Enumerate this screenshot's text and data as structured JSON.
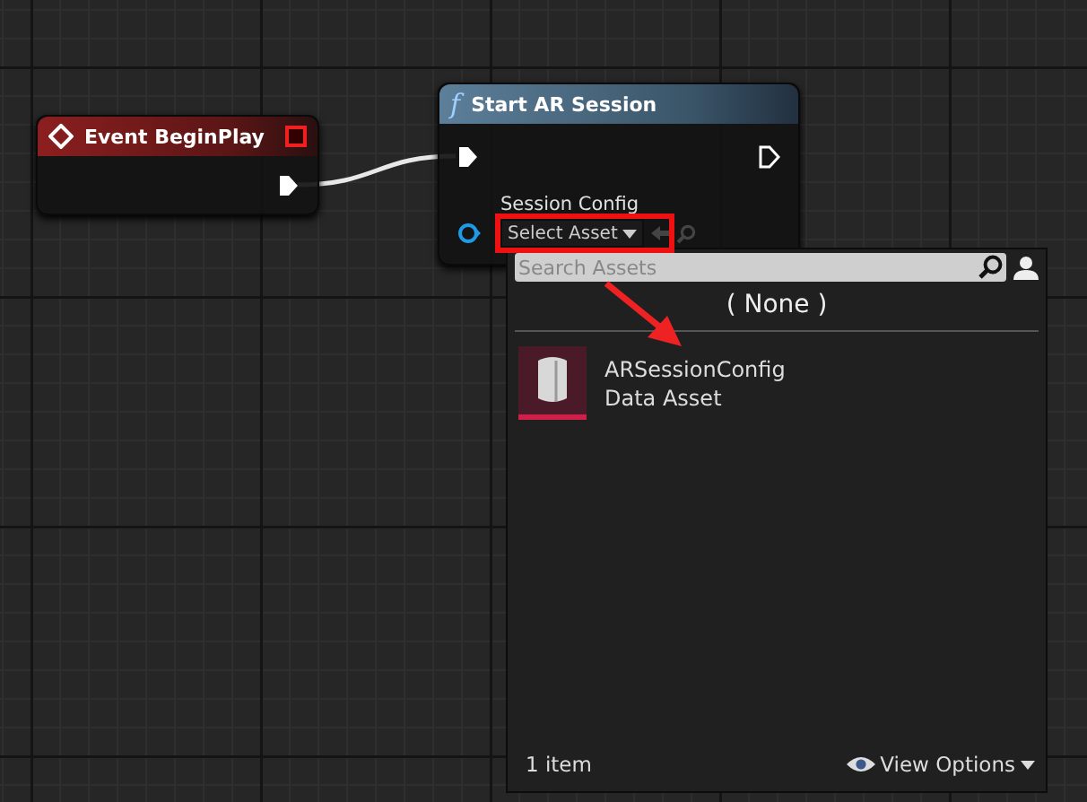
{
  "nodes": [
    {
      "kind": "event",
      "title": "Event BeginPlay"
    },
    {
      "kind": "function",
      "icon_text": "f",
      "title": "Start AR Session",
      "pin_label": "Session Config",
      "select_label": "Select Asset"
    }
  ],
  "picker": {
    "search": {
      "placeholder": "Search Assets"
    },
    "none_option": "( None )",
    "assets": [
      {
        "name": "ARSessionConfig",
        "type": "Data Asset"
      }
    ],
    "count": "1 item",
    "view_options": "View Options"
  }
}
